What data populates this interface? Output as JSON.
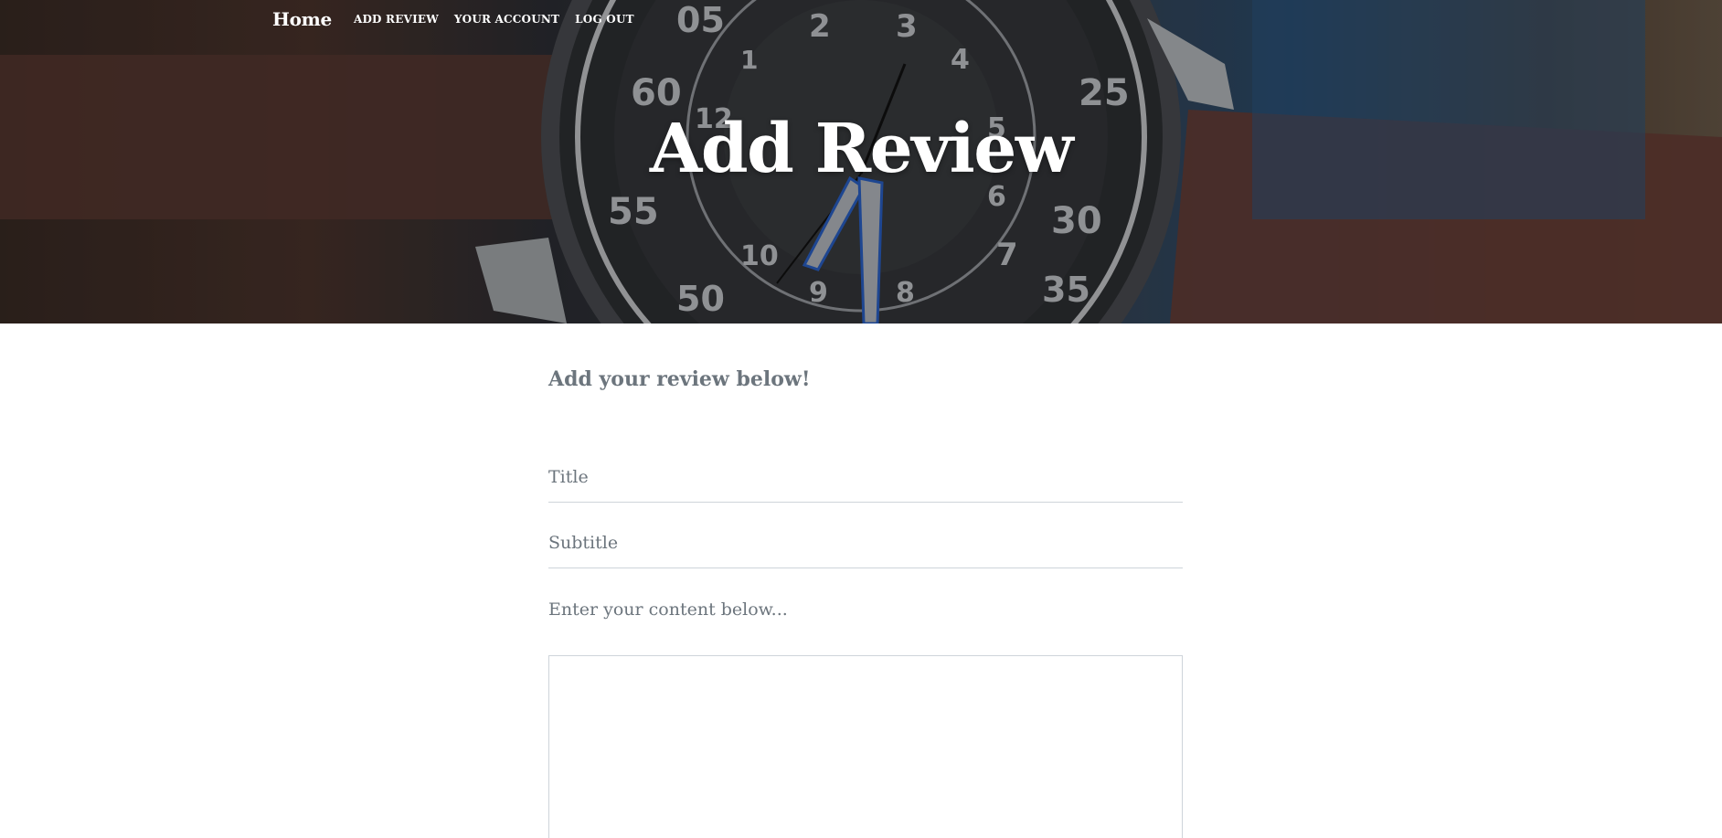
{
  "nav": {
    "brand": "Home",
    "links": [
      "ADD REVIEW",
      "YOUR ACCOUNT",
      "LOG OUT"
    ]
  },
  "hero": {
    "title": "Add Review"
  },
  "form": {
    "heading": "Add your review below!",
    "title_placeholder": "Title",
    "subtitle_placeholder": "Subtitle",
    "content_label": "Enter your content below...",
    "content_value": ""
  },
  "colors": {
    "text_muted": "#6c757d",
    "border": "#ced4da",
    "hero_text": "#ffffff"
  }
}
